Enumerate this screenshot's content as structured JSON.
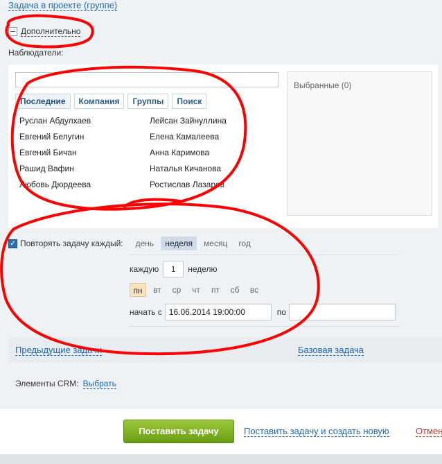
{
  "links": {
    "project": "Задача в проекте (группе)"
  },
  "extra": {
    "label": "Дополнительно"
  },
  "observers": {
    "label": "Наблюдатели:",
    "search_value": "",
    "tabs": [
      "Последние",
      "Компания",
      "Группы",
      "Поиск"
    ],
    "people": [
      "Руслан Абдулхаев",
      "Лейсан Зайнуллина",
      "Евгений Белугин",
      "Елена Камалеева",
      "Евгений Бичан",
      "Анна Каримова",
      "Рашид Вафин",
      "Наталья Кичанова",
      "Любовь Дюрдеева",
      "Ростислав Лазарев"
    ],
    "selected": "Выбранные (0)"
  },
  "repeat": {
    "label": "Повторять задачу каждый:",
    "checked": true,
    "periods": [
      "день",
      "неделя",
      "месяц",
      "год"
    ],
    "active_period": "неделя",
    "every_prefix": "каждую",
    "every_value": "1",
    "every_suffix": "неделю",
    "days": [
      "пн",
      "вт",
      "ср",
      "чт",
      "пт",
      "сб",
      "вс"
    ],
    "active_day": "пн",
    "start_label": "начать с",
    "start_value": "16.06.2014 19:00:00",
    "end_label": "по",
    "end_value": ""
  },
  "related": {
    "prev_tasks": "Предыдущие задачи",
    "base_task": "Базовая задача"
  },
  "crm": {
    "label": "Элементы CRM:",
    "choose": "Выбрать"
  },
  "footer": {
    "submit": "Поставить задачу",
    "submit_new": "Поставить задачу и создать новую",
    "cancel": "Отмен"
  },
  "colors": {
    "link": "#2067b0",
    "submit_green": "#7bb01e",
    "annotation_red": "#ff0000"
  }
}
